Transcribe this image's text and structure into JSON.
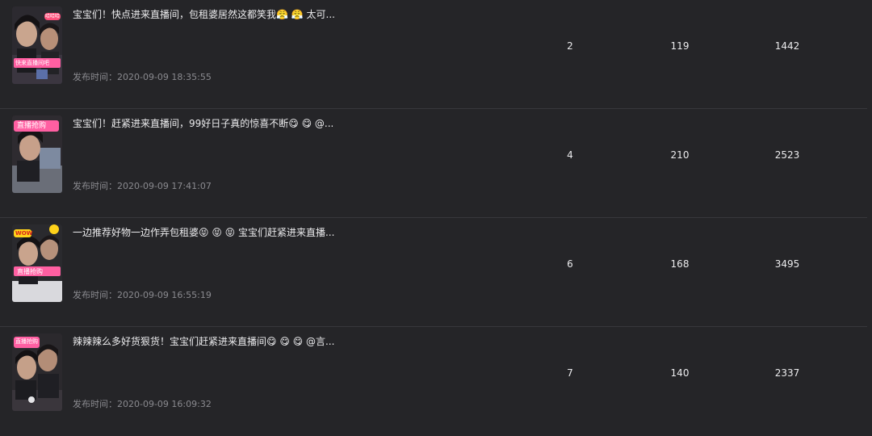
{
  "videos": [
    {
      "title": "宝宝们！快点进来直播间，包租婆居然这都笑我😤 😤 太可...",
      "time_label": "发布时间：",
      "time": "2020-09-09 18:35:55",
      "thumb_caption_top": "哈哈哈",
      "thumb_caption_bottom": "快来直播间吧",
      "stat1": "2",
      "stat2": "119",
      "stat3": "1442"
    },
    {
      "title": "宝宝们！赶紧进来直播间，99好日子真的惊喜不断😋 😋 @...",
      "time_label": "发布时间：",
      "time": "2020-09-09 17:41:07",
      "thumb_caption_top": "直播抢购",
      "thumb_caption_bottom": "",
      "stat1": "4",
      "stat2": "210",
      "stat3": "2523"
    },
    {
      "title": "一边推荐好物一边作弄包租婆😝 😝 😝 宝宝们赶紧进来直播...",
      "time_label": "发布时间：",
      "time": "2020-09-09 16:55:19",
      "thumb_caption_top": "WOW",
      "thumb_caption_bottom": "直播抢购",
      "stat1": "6",
      "stat2": "168",
      "stat3": "3495"
    },
    {
      "title": "辣辣辣么多好货狠货！宝宝们赶紧进来直播间😋 😋 😋 @言...",
      "time_label": "发布时间：",
      "time": "2020-09-09 16:09:32",
      "thumb_caption_top": "直播抢购",
      "thumb_caption_bottom": "",
      "stat1": "7",
      "stat2": "140",
      "stat3": "2337"
    }
  ]
}
